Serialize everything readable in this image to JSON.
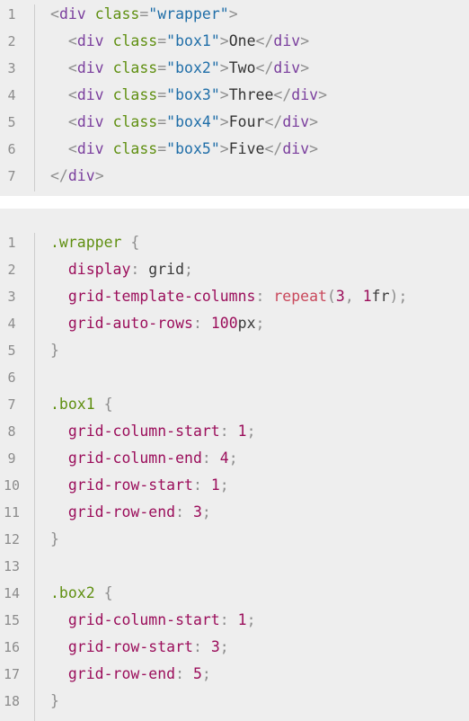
{
  "html_snippet": {
    "lines": [
      {
        "n": "1",
        "tokens": [
          {
            "t": "<",
            "c": "punc"
          },
          {
            "t": "div",
            "c": "tag"
          },
          {
            "t": " ",
            "c": "plain"
          },
          {
            "t": "class",
            "c": "attr"
          },
          {
            "t": "=",
            "c": "punc"
          },
          {
            "t": "\"wrapper\"",
            "c": "str"
          },
          {
            "t": ">",
            "c": "punc"
          }
        ]
      },
      {
        "n": "2",
        "tokens": [
          {
            "t": "  <",
            "c": "punc"
          },
          {
            "t": "div",
            "c": "tag"
          },
          {
            "t": " ",
            "c": "plain"
          },
          {
            "t": "class",
            "c": "attr"
          },
          {
            "t": "=",
            "c": "punc"
          },
          {
            "t": "\"box1\"",
            "c": "str"
          },
          {
            "t": ">",
            "c": "punc"
          },
          {
            "t": "One",
            "c": "plain"
          },
          {
            "t": "</",
            "c": "punc"
          },
          {
            "t": "div",
            "c": "tag"
          },
          {
            "t": ">",
            "c": "punc"
          }
        ]
      },
      {
        "n": "3",
        "tokens": [
          {
            "t": "  <",
            "c": "punc"
          },
          {
            "t": "div",
            "c": "tag"
          },
          {
            "t": " ",
            "c": "plain"
          },
          {
            "t": "class",
            "c": "attr"
          },
          {
            "t": "=",
            "c": "punc"
          },
          {
            "t": "\"box2\"",
            "c": "str"
          },
          {
            "t": ">",
            "c": "punc"
          },
          {
            "t": "Two",
            "c": "plain"
          },
          {
            "t": "</",
            "c": "punc"
          },
          {
            "t": "div",
            "c": "tag"
          },
          {
            "t": ">",
            "c": "punc"
          }
        ]
      },
      {
        "n": "4",
        "tokens": [
          {
            "t": "  <",
            "c": "punc"
          },
          {
            "t": "div",
            "c": "tag"
          },
          {
            "t": " ",
            "c": "plain"
          },
          {
            "t": "class",
            "c": "attr"
          },
          {
            "t": "=",
            "c": "punc"
          },
          {
            "t": "\"box3\"",
            "c": "str"
          },
          {
            "t": ">",
            "c": "punc"
          },
          {
            "t": "Three",
            "c": "plain"
          },
          {
            "t": "</",
            "c": "punc"
          },
          {
            "t": "div",
            "c": "tag"
          },
          {
            "t": ">",
            "c": "punc"
          }
        ]
      },
      {
        "n": "5",
        "tokens": [
          {
            "t": "  <",
            "c": "punc"
          },
          {
            "t": "div",
            "c": "tag"
          },
          {
            "t": " ",
            "c": "plain"
          },
          {
            "t": "class",
            "c": "attr"
          },
          {
            "t": "=",
            "c": "punc"
          },
          {
            "t": "\"box4\"",
            "c": "str"
          },
          {
            "t": ">",
            "c": "punc"
          },
          {
            "t": "Four",
            "c": "plain"
          },
          {
            "t": "</",
            "c": "punc"
          },
          {
            "t": "div",
            "c": "tag"
          },
          {
            "t": ">",
            "c": "punc"
          }
        ]
      },
      {
        "n": "6",
        "tokens": [
          {
            "t": "  <",
            "c": "punc"
          },
          {
            "t": "div",
            "c": "tag"
          },
          {
            "t": " ",
            "c": "plain"
          },
          {
            "t": "class",
            "c": "attr"
          },
          {
            "t": "=",
            "c": "punc"
          },
          {
            "t": "\"box5\"",
            "c": "str"
          },
          {
            "t": ">",
            "c": "punc"
          },
          {
            "t": "Five",
            "c": "plain"
          },
          {
            "t": "</",
            "c": "punc"
          },
          {
            "t": "div",
            "c": "tag"
          },
          {
            "t": ">",
            "c": "punc"
          }
        ]
      },
      {
        "n": "7",
        "tokens": [
          {
            "t": "</",
            "c": "punc"
          },
          {
            "t": "div",
            "c": "tag"
          },
          {
            "t": ">",
            "c": "punc"
          }
        ]
      }
    ]
  },
  "css_snippet": {
    "lines": [
      {
        "n": "1",
        "tokens": [
          {
            "t": ".wrapper",
            "c": "sel"
          },
          {
            "t": " {",
            "c": "punc"
          }
        ]
      },
      {
        "n": "2",
        "tokens": [
          {
            "t": "  display",
            "c": "prop"
          },
          {
            "t": ": ",
            "c": "punc"
          },
          {
            "t": "grid",
            "c": "val"
          },
          {
            "t": ";",
            "c": "punc"
          }
        ]
      },
      {
        "n": "3",
        "tokens": [
          {
            "t": "  grid-template-columns",
            "c": "prop"
          },
          {
            "t": ": ",
            "c": "punc"
          },
          {
            "t": "repeat",
            "c": "fn"
          },
          {
            "t": "(",
            "c": "punc"
          },
          {
            "t": "3",
            "c": "num"
          },
          {
            "t": ", ",
            "c": "punc"
          },
          {
            "t": "1",
            "c": "num"
          },
          {
            "t": "fr",
            "c": "val"
          },
          {
            "t": ");",
            "c": "punc"
          }
        ]
      },
      {
        "n": "4",
        "tokens": [
          {
            "t": "  grid-auto-rows",
            "c": "prop"
          },
          {
            "t": ": ",
            "c": "punc"
          },
          {
            "t": "100",
            "c": "num"
          },
          {
            "t": "px",
            "c": "val"
          },
          {
            "t": ";",
            "c": "punc"
          }
        ]
      },
      {
        "n": "5",
        "tokens": [
          {
            "t": "}",
            "c": "punc"
          }
        ]
      },
      {
        "n": "6",
        "tokens": []
      },
      {
        "n": "7",
        "tokens": [
          {
            "t": ".box1",
            "c": "sel"
          },
          {
            "t": " {",
            "c": "punc"
          }
        ]
      },
      {
        "n": "8",
        "tokens": [
          {
            "t": "  grid-column-start",
            "c": "prop"
          },
          {
            "t": ": ",
            "c": "punc"
          },
          {
            "t": "1",
            "c": "num"
          },
          {
            "t": ";",
            "c": "punc"
          }
        ]
      },
      {
        "n": "9",
        "tokens": [
          {
            "t": "  grid-column-end",
            "c": "prop"
          },
          {
            "t": ": ",
            "c": "punc"
          },
          {
            "t": "4",
            "c": "num"
          },
          {
            "t": ";",
            "c": "punc"
          }
        ]
      },
      {
        "n": "10",
        "tokens": [
          {
            "t": "  grid-row-start",
            "c": "prop"
          },
          {
            "t": ": ",
            "c": "punc"
          },
          {
            "t": "1",
            "c": "num"
          },
          {
            "t": ";",
            "c": "punc"
          }
        ]
      },
      {
        "n": "11",
        "tokens": [
          {
            "t": "  grid-row-end",
            "c": "prop"
          },
          {
            "t": ": ",
            "c": "punc"
          },
          {
            "t": "3",
            "c": "num"
          },
          {
            "t": ";",
            "c": "punc"
          }
        ]
      },
      {
        "n": "12",
        "tokens": [
          {
            "t": "}",
            "c": "punc"
          }
        ]
      },
      {
        "n": "13",
        "tokens": []
      },
      {
        "n": "14",
        "tokens": [
          {
            "t": ".box2",
            "c": "sel"
          },
          {
            "t": " {",
            "c": "punc"
          }
        ]
      },
      {
        "n": "15",
        "tokens": [
          {
            "t": "  grid-column-start",
            "c": "prop"
          },
          {
            "t": ": ",
            "c": "punc"
          },
          {
            "t": "1",
            "c": "num"
          },
          {
            "t": ";",
            "c": "punc"
          }
        ]
      },
      {
        "n": "16",
        "tokens": [
          {
            "t": "  grid-row-start",
            "c": "prop"
          },
          {
            "t": ": ",
            "c": "punc"
          },
          {
            "t": "3",
            "c": "num"
          },
          {
            "t": ";",
            "c": "punc"
          }
        ]
      },
      {
        "n": "17",
        "tokens": [
          {
            "t": "  grid-row-end",
            "c": "prop"
          },
          {
            "t": ": ",
            "c": "punc"
          },
          {
            "t": "5",
            "c": "num"
          },
          {
            "t": ";",
            "c": "punc"
          }
        ]
      },
      {
        "n": "18",
        "tokens": [
          {
            "t": "}",
            "c": "punc"
          }
        ]
      }
    ]
  }
}
